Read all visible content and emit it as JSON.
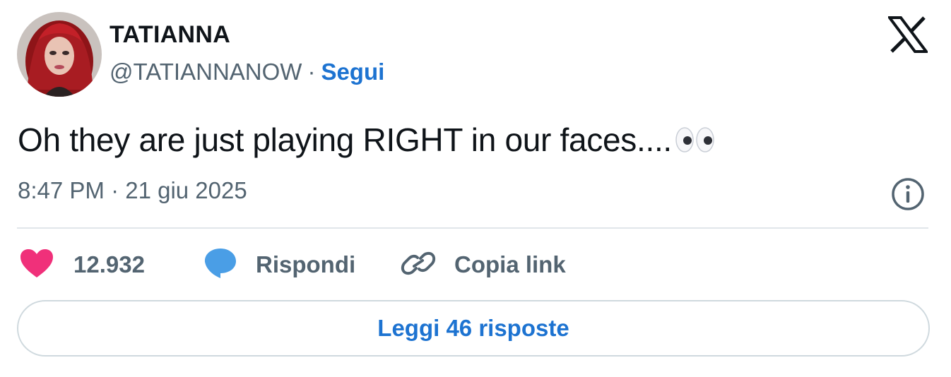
{
  "author": {
    "display_name": "TATIANNA",
    "handle": "@TATIANNANOW",
    "separator": "·",
    "follow_label": "Segui"
  },
  "tweet": {
    "text": "Oh they are just playing RIGHT in our faces....",
    "emoji_icon": "eyes-emoji",
    "timestamp": "8:47 PM · 21 giu 2025"
  },
  "actions": {
    "like_count": "12.932",
    "reply_label": "Rispondi",
    "copy_link_label": "Copia link"
  },
  "footer": {
    "read_replies_label": "Leggi 46 risposte"
  },
  "icons": {
    "brand": "x-logo-icon",
    "info": "info-icon",
    "like": "heart-icon",
    "reply": "speech-bubble-icon",
    "copy": "link-icon"
  },
  "colors": {
    "accent": "#1d73d1",
    "like": "#f0307a",
    "reply": "#4a9ee6",
    "muted": "#536471",
    "text": "#0f1419"
  }
}
